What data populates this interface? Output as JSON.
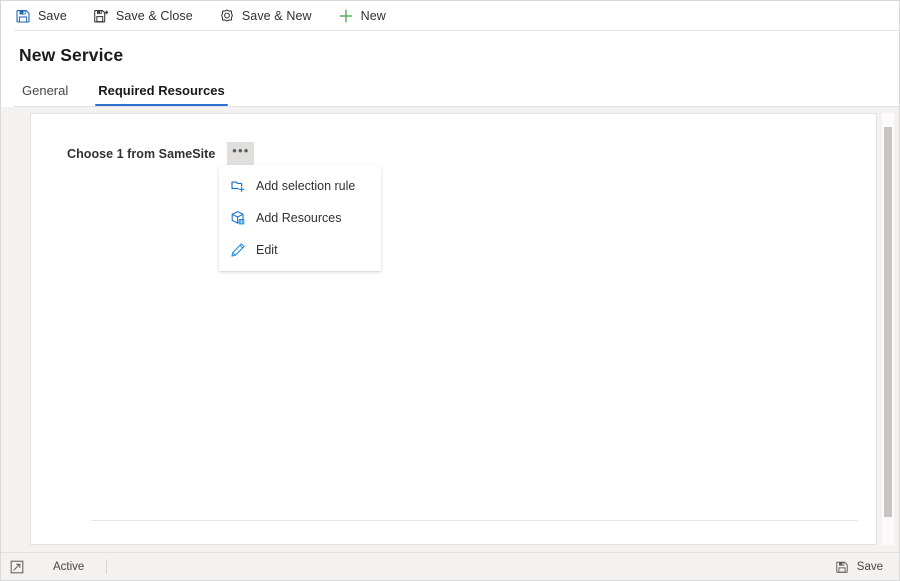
{
  "toolbar": {
    "buttons": [
      {
        "label": "Save",
        "icon": "save-floppy-icon"
      },
      {
        "label": "Save & Close",
        "icon": "save-close-floppy-icon"
      },
      {
        "label": "Save & New",
        "icon": "save-new-circle-icon"
      },
      {
        "label": "New",
        "icon": "plus-icon"
      }
    ]
  },
  "header": {
    "title": "New Service",
    "tabs": [
      {
        "label": "General",
        "active": false
      },
      {
        "label": "Required Resources",
        "active": true
      }
    ]
  },
  "form": {
    "section_label": "Choose 1 from SameSite",
    "ellipsis_label": "•••"
  },
  "context_menu": {
    "items": [
      {
        "label": "Add selection rule",
        "icon": "add-selection-rule-icon"
      },
      {
        "label": "Add Resources",
        "icon": "add-resources-box-icon"
      },
      {
        "label": "Edit",
        "icon": "edit-pencil-icon"
      }
    ]
  },
  "status_bar": {
    "expand_icon": "expand-icon",
    "state": "Active",
    "save_label": "Save",
    "save_icon": "save-floppy-gray-icon"
  },
  "colors": {
    "accent_blue": "#2f6fd0",
    "icon_blue": "#0f6cbd",
    "new_green": "#3ca13c",
    "panel_bg": "#f3f2f1",
    "button_gray": "#e1dfdd"
  }
}
